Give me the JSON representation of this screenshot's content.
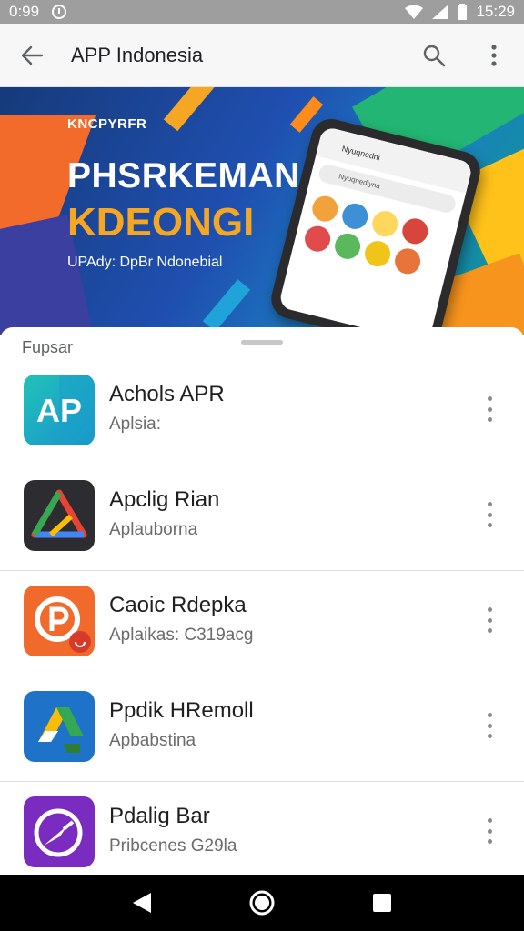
{
  "status_bar": {
    "time_left": "0:99",
    "time_right": "15:29",
    "icons": [
      "circle-indicator-icon",
      "wifi-icon",
      "signal-icon",
      "battery-icon"
    ]
  },
  "app_bar": {
    "title": "APP Indonesia",
    "icons": [
      "back-arrow-icon",
      "search-icon",
      "more-vertical-icon"
    ]
  },
  "banner": {
    "small_text": "KNCPYRFR",
    "headline_1": "PHSRKEMANA",
    "headline_2": "KDEONGI",
    "subtitle": "UPAdy: DpBr Ndonebial",
    "phone_header": "Nyuqnedni",
    "phone_search": "Nyuqnediyna"
  },
  "sheet": {
    "section_label": "Fupsar"
  },
  "apps": [
    {
      "name": "Achols APR",
      "subtitle": "Aplsia:",
      "icon": "ap-logo-icon",
      "color": "#1fb5b5"
    },
    {
      "name": "Apclig Rian",
      "subtitle": "Aplauborna",
      "icon": "triangle-logo-icon",
      "color": "#2d2d31"
    },
    {
      "name": "Caoic Rdepka",
      "subtitle": "Aplaikas: C319acg",
      "icon": "p-chat-logo-icon",
      "color": "#f06a2c"
    },
    {
      "name": "Ppdik HRemoll",
      "subtitle": "Apbabstina",
      "icon": "drive-logo-icon",
      "color": "#1e73c9"
    },
    {
      "name": "Pdalig Bar",
      "subtitle": "Pribcenes G29la",
      "icon": "compass-logo-icon",
      "color": "#7a2cc0"
    }
  ],
  "nav_bar": {
    "icons": [
      "back-triangle-icon",
      "home-circle-icon",
      "recents-square-icon"
    ]
  },
  "colors": {
    "accent": "#f5a623",
    "status_bar": "#9e9e9e",
    "app_bar": "#f7f7f7"
  }
}
